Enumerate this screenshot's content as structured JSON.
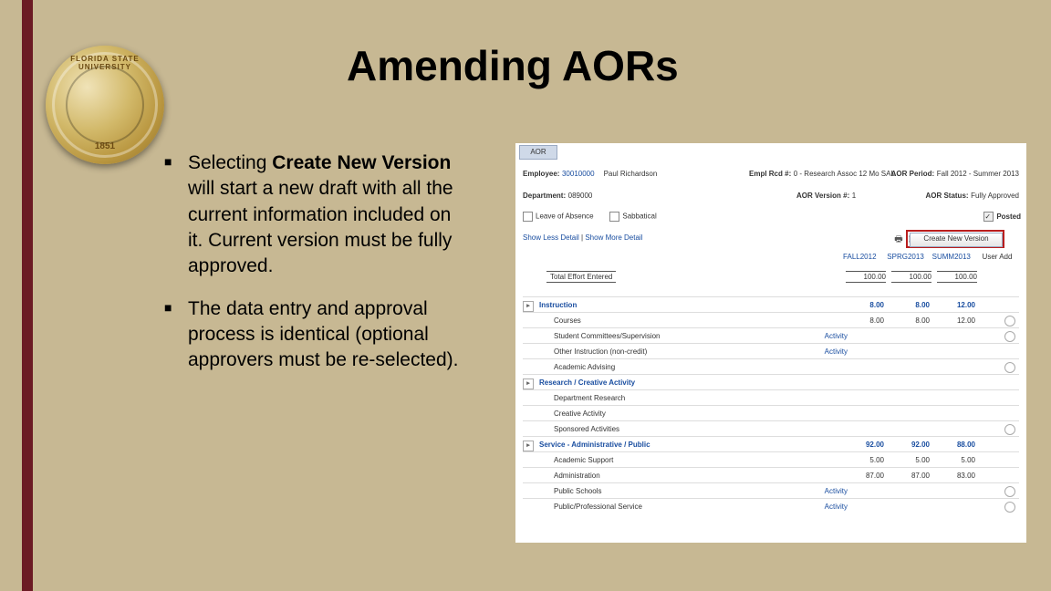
{
  "title": "Amending AORs",
  "seal": {
    "top": "FLORIDA STATE UNIVERSITY",
    "year": "1851"
  },
  "bullets": {
    "b1_pre": "Selecting ",
    "b1_bold": "Create New Version",
    "b1_post": " will start a new draft with all the current information included on it. Current version must be fully approved.",
    "b2": "The data entry and approval process is identical (optional approvers must be re-selected)."
  },
  "app": {
    "tab": "AOR",
    "employee_lbl": "Employee:",
    "employee_link": "30010000",
    "employee_name": "Paul Richardson",
    "empl_lbl": "Empl Rcd #:",
    "empl_val": "0 - Research Assoc 12 Mo SAL",
    "period_lbl": "AOR Period:",
    "period_val": "Fall 2012 - Summer 2013",
    "dept_lbl": "Department:",
    "dept_val": "089000",
    "ver_lbl": "AOR Version #:",
    "ver_val": "1",
    "status_lbl": "AOR Status:",
    "status_val": "Fully Approved",
    "leave": "Leave of Absence",
    "sabbatical": "Sabbatical",
    "posted": "Posted",
    "show_less": "Show Less Detail",
    "show_more": "Show More Detail",
    "create_btn": "Create New Version",
    "p1": "FALL2012",
    "p2": "SPRG2013",
    "p3": "SUMM2013",
    "ua": "User Add",
    "total_lbl": "Total Effort Entered",
    "t1": "100.00",
    "t2": "100.00",
    "t3": "100.00",
    "rows": [
      {
        "head": true,
        "label": "Instruction",
        "v1": "8.00",
        "v2": "8.00",
        "v3": "12.00"
      },
      {
        "label": "Courses",
        "v1": "8.00",
        "v2": "8.00",
        "v3": "12.00",
        "circle": true
      },
      {
        "label": "Student Committees/Supervision",
        "link": "Activity",
        "circle": true
      },
      {
        "label": "Other Instruction (non-credit)",
        "link": "Activity"
      },
      {
        "label": "Academic Advising",
        "circle": true
      },
      {
        "head": true,
        "label": "Research / Creative Activity"
      },
      {
        "label": "Department Research"
      },
      {
        "label": "Creative Activity"
      },
      {
        "label": "Sponsored Activities",
        "circle": true
      },
      {
        "head": true,
        "label": "Service - Administrative / Public",
        "v1": "92.00",
        "v2": "92.00",
        "v3": "88.00"
      },
      {
        "label": "Academic Support",
        "v1": "5.00",
        "v2": "5.00",
        "v3": "5.00"
      },
      {
        "label": "Administration",
        "v1": "87.00",
        "v2": "87.00",
        "v3": "83.00"
      },
      {
        "label": "Public Schools",
        "link": "Activity",
        "circle": true
      },
      {
        "label": "Public/Professional Service",
        "link": "Activity",
        "circle": true
      }
    ]
  }
}
